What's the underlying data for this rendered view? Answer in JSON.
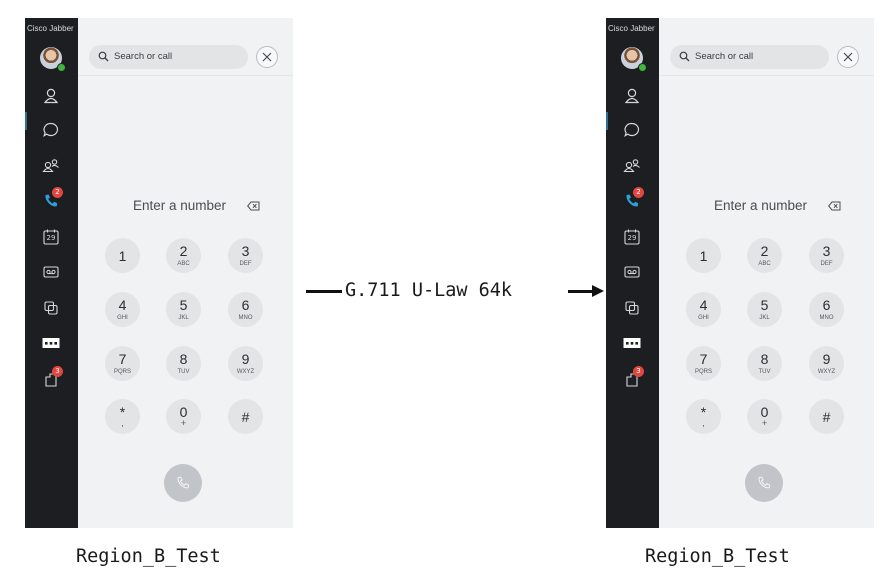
{
  "app_title": "Cisco Jabber",
  "search": {
    "placeholder": "Search or call"
  },
  "dialer": {
    "entry_placeholder": "Enter a number",
    "keys": [
      {
        "digit": "1",
        "letters": ""
      },
      {
        "digit": "2",
        "letters": "ABC"
      },
      {
        "digit": "3",
        "letters": "DEF"
      },
      {
        "digit": "4",
        "letters": "GHI"
      },
      {
        "digit": "5",
        "letters": "JKL"
      },
      {
        "digit": "6",
        "letters": "MNO"
      },
      {
        "digit": "7",
        "letters": "PQRS"
      },
      {
        "digit": "8",
        "letters": "TUV"
      },
      {
        "digit": "9",
        "letters": "WXYZ"
      },
      {
        "digit": "*",
        "letters": ","
      },
      {
        "digit": "0",
        "letters": "+"
      },
      {
        "digit": "#",
        "letters": ""
      }
    ]
  },
  "nav": {
    "calls_badge": "2",
    "calendar_day": "29",
    "custom_tab_badge": "3"
  },
  "codec_label": "G.711 U-Law 64k",
  "captions": {
    "left": "Region_B_Test",
    "right": "Region_B_Test"
  },
  "colors": {
    "rail": "#1c1e21",
    "panel": "#f1f2f3",
    "key": "#e2e4e6",
    "badge": "#e2473f",
    "phone_active": "#2f9fd8",
    "presence": "#3fb43f"
  }
}
